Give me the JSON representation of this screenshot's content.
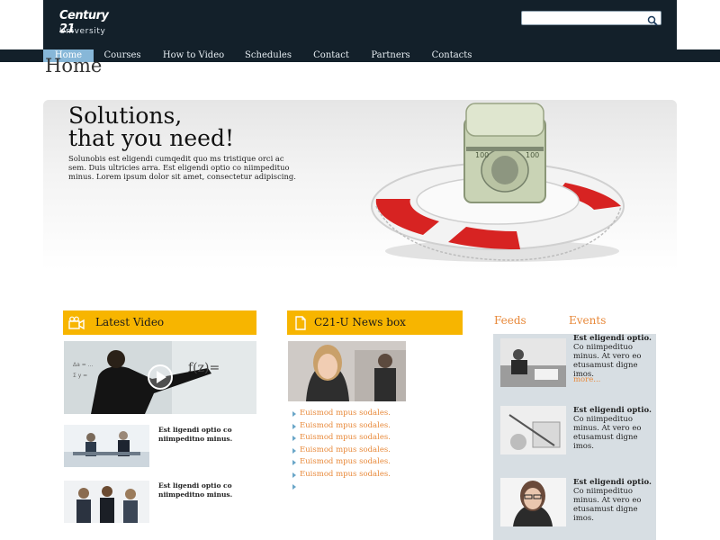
{
  "header": {
    "logo_mark": "Century 21",
    "logo_sub": "University",
    "search_placeholder": ""
  },
  "nav": {
    "items": [
      {
        "label": "Home",
        "active": true
      },
      {
        "label": "Courses"
      },
      {
        "label": "How to Video"
      },
      {
        "label": "Schedules"
      },
      {
        "label": "Contact"
      },
      {
        "label": "Partners"
      },
      {
        "label": "Contacts"
      }
    ]
  },
  "page_title": "Home",
  "hero": {
    "title": "Solutions,\nthat you need!",
    "text": "Solunobis est eligendi cumqedit quo ms tristique orci ac sem. Duis ultricies arra. Est eligendi optio co niimpedituo minus. Lorem ipsum dolor sit amet, consectetur adipiscing."
  },
  "video": {
    "header": "Latest Video",
    "items": [
      {
        "caption": "Est ligendi optio co niimpeditno minus."
      },
      {
        "caption": "Est ligendi optio co niimpeditno minus."
      }
    ]
  },
  "news": {
    "header": "C21-U News box",
    "items": [
      "Euismod mpus sodales.",
      "Euismod mpus sodales.",
      "Euismod mpus sodales.",
      "Euismod mpus sodales.",
      "Euismod mpus sodales.",
      "Euismod mpus sodales.",
      ""
    ]
  },
  "feeds": {
    "tab_feeds": "Feeds",
    "tab_events": "Events",
    "items": [
      {
        "title": "Est eligendi optio.",
        "text": "Co niimpedituo minus. At vero eo etusamust digne imos.",
        "more": "more..."
      },
      {
        "title": "Est eligendi optio.",
        "text": "Co niimpedituo minus. At vero eo etusamust digne imos.",
        "more": ""
      },
      {
        "title": "Est eligendi optio.",
        "text": "Co niimpedituo minus. At vero eo etusamust digne imos.",
        "more": ""
      }
    ]
  },
  "colors": {
    "header_bg": "#13202a",
    "accent_yellow": "#f7b500",
    "link_orange": "#e8893a",
    "nav_active": "#87b7d8",
    "panel_bg": "#d7dee3"
  }
}
